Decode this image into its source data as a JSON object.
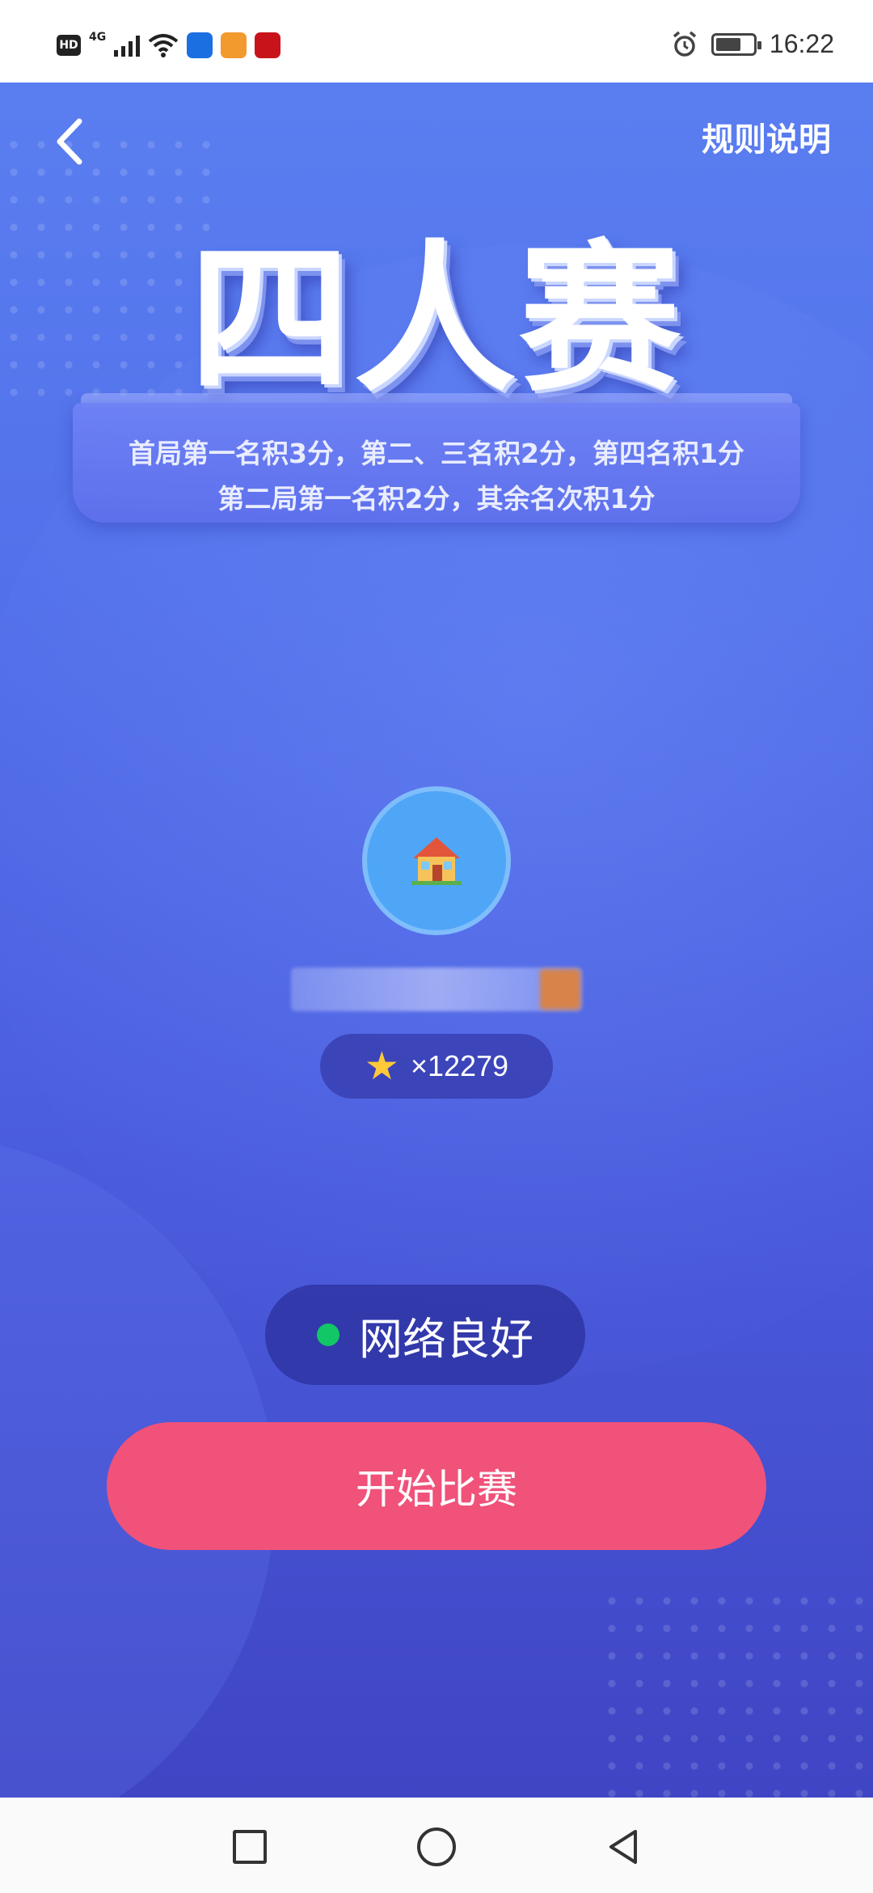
{
  "status_bar": {
    "time": "16:22",
    "left_icons": [
      "hd-icon",
      "4g-icon",
      "signal-icon",
      "wifi-icon",
      "app-icon-blue",
      "app-icon-orange",
      "app-icon-red"
    ],
    "hd_label": "HD",
    "network_label": "4G"
  },
  "header": {
    "rules_label": "规则说明"
  },
  "title": "四人赛",
  "rules": {
    "line1": "首局第一名积3分，第二、三名积2分，第四名积1分",
    "line2": "第二局第一名积2分，其余名次积1分"
  },
  "player": {
    "stars_text": "×12279"
  },
  "network_status": {
    "label": "网络良好",
    "color": "#12c765"
  },
  "start_button": {
    "label": "开始比赛",
    "color": "#f0527a"
  }
}
